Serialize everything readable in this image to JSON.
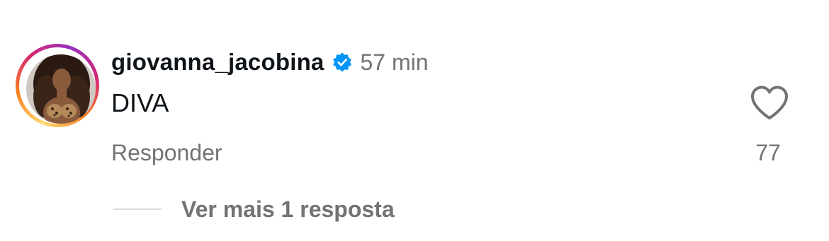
{
  "comment": {
    "username": "giovanna_jacobina",
    "verified": true,
    "time": "57 min",
    "text": "DIVA",
    "like_count": "77",
    "reply_label": "Responder",
    "view_replies_label": "Ver mais 1 resposta"
  },
  "icons": {
    "like": "heart-outline-icon",
    "verified": "verified-badge-icon"
  },
  "colors": {
    "text": "#0f1419",
    "secondary": "#737373",
    "verified": "#0095f6",
    "divider": "#dbdbdb"
  }
}
